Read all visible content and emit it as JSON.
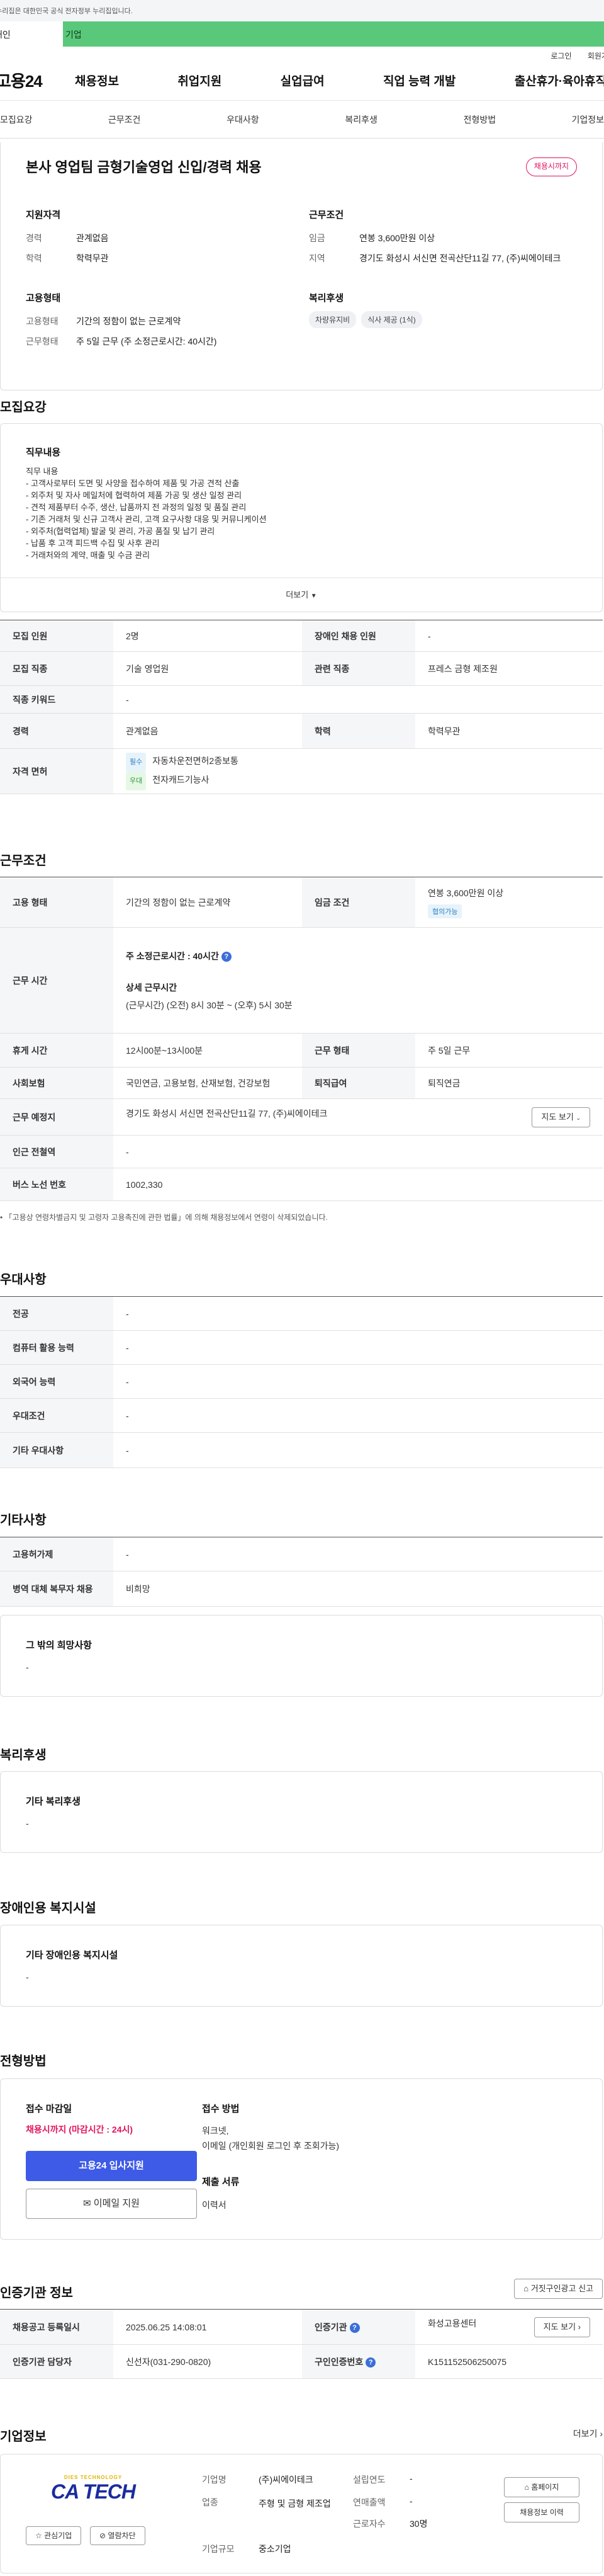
{
  "gov_bar": {
    "text": "이 누리집은 대한민국 공식 전자정부 누리집입니다."
  },
  "channel_tabs": {
    "personal": "개인",
    "corporate": "기업"
  },
  "util": {
    "login": "로그인",
    "signup": "회원가입"
  },
  "gnb": {
    "logo": "고용24",
    "menu": [
      "채용정보",
      "취업지원",
      "실업급여",
      "직업 능력 개발",
      "출산휴가·육아휴직"
    ]
  },
  "subnav": [
    "모집요강",
    "근무조건",
    "우대사항",
    "복리후생",
    "전형방법",
    "기업정보"
  ],
  "summary": {
    "title": "본사 영업팀 금형기술영업 신입/경력 채용",
    "deadline_badge": "채용시까지",
    "qualification": {
      "label": "지원자격",
      "career_k": "경력",
      "career_v": "관계없음",
      "edu_k": "학력",
      "edu_v": "학력무관"
    },
    "conditions": {
      "label": "근무조건",
      "wage_k": "임금",
      "wage_v": "연봉 3,600만원 이상",
      "region_k": "지역",
      "region_v": "경기도 화성시 서신면 전곡산단11길 77, (주)씨에이테크"
    },
    "employment": {
      "label": "고용형태",
      "type_k": "고용형태",
      "type_v": "기간의 정함이 없는 근로계약",
      "hours_k": "근무형태",
      "hours_v": "주 5일 근무 (주 소정근로시간: 40시간)"
    },
    "welfare": {
      "label": "복리후생",
      "chips": [
        "차량유지비",
        "식사 제공 (1식)"
      ]
    }
  },
  "recruit": {
    "section_title": "모집요강",
    "duty_label": "직무내용",
    "duty_lines": [
      "직무 내용",
      "- 고객사로부터 도면 및 사양을 접수하여 제품 및 가공 견적 산출",
      "- 외주처 및 자사 메일처에 협력하여 제품 가공 및 생산 일정 관리",
      "- 견적 제품부터 수주, 생산, 납품까지 전 과정의 일정 및 품질 관리",
      "- 기존 거래처 및 신규 고객사 관리, 고객 요구사항 대응 및 커뮤니케이션",
      "- 외주처(협력업체) 발굴 및 관리, 가공 품질 및 납기 관리",
      "- 납품 후 고객 피드백 수집 및 사후 관리",
      "- 거래처와의 계약, 매출 및 수금 관리"
    ],
    "more": "더보기",
    "rows": {
      "count_k": "모집 인원",
      "count_v": "2명",
      "disabled_k": "장애인 채용 인원",
      "disabled_v": "-",
      "job_k": "모집 직종",
      "job_v": "기술 영업원",
      "related_k": "관련 직종",
      "related_v": "프레스 금형 제조원",
      "keyword_k": "직종 키워드",
      "keyword_v": "-",
      "career_k": "경력",
      "career_v": "관계없음",
      "edu_k": "학력",
      "edu_v": "학력무관",
      "license_k": "자격 면허",
      "license_req_tag": "필수",
      "license_req": "자동차운전면허2종보통",
      "license_pref_tag": "우대",
      "license_pref": "전자캐드기능사"
    }
  },
  "work": {
    "section_title": "근무조건",
    "type_k": "고용 형태",
    "type_v": "기간의 정함이 없는 근로계약",
    "wage_k": "임금 조건",
    "wage_v": "연봉 3,600만원 이상",
    "wage_badge": "협의가능",
    "time_k": "근무 시간",
    "time_week": "주 소정근로시간 : 40시간",
    "time_detail_label": "상세 근무시간",
    "time_detail": "(근무시간) (오전) 8시 30분 ~ (오후) 5시 30분",
    "break_k": "휴게 시간",
    "break_v": "12시00분~13시00분",
    "shift_k": "근무 형태",
    "shift_v": "주 5일 근무",
    "insurance_k": "사회보험",
    "insurance_v": "국민연금, 고용보험, 산재보험, 건강보험",
    "retire_k": "퇴직급여",
    "retire_v": "퇴직연금",
    "place_k": "근무 예정지",
    "place_v": "경기도 화성시 서신면 전곡산단11길 77, (주)씨에이테크",
    "map_btn": "지도 보기",
    "subway_k": "인근 전철역",
    "subway_v": "-",
    "bus_k": "버스 노선 번호",
    "bus_v": "1002,330",
    "note": "「고용상 연령차별금지 및 고령자 고용촉진에 관한 법률」에 의해 채용정보에서 연령이 삭제되었습니다."
  },
  "pref": {
    "section_title": "우대사항",
    "rows": [
      {
        "k": "전공",
        "v": "-"
      },
      {
        "k": "컴퓨터 활용 능력",
        "v": "-"
      },
      {
        "k": "외국어 능력",
        "v": "-"
      },
      {
        "k": "우대조건",
        "v": "-"
      },
      {
        "k": "기타 우대사항",
        "v": "-"
      }
    ]
  },
  "etc": {
    "section_title": "기타사항",
    "rows": [
      {
        "k": "고용허가제",
        "v": "-"
      },
      {
        "k": "병역 대체 복무자 채용",
        "v": "비희망"
      }
    ],
    "other_label": "그 밖의 희망사항",
    "other_v": "-"
  },
  "benefit": {
    "section_title": "복리후생",
    "label": "기타 복리후생",
    "v": "-"
  },
  "disabled_fac": {
    "section_title": "장애인용 복지시설",
    "label": "기타 장애인용 복지시설",
    "v": "-"
  },
  "apply": {
    "section_title": "전형방법",
    "deadline_label": "접수 마감일",
    "deadline_v": "채용시까지 (마감시간 : 24시)",
    "apply_btn": "고용24 입사지원",
    "email_btn": "이메일 지원",
    "method_label": "접수 방법",
    "method_v1": "워크넷,",
    "method_v2": "이메일 (개인회원 로그인 후 조회가능)",
    "docs_label": "제출 서류",
    "docs_v": "이력서"
  },
  "cert": {
    "section_title": "인증기관 정보",
    "report_btn": "거짓구인광고 신고",
    "reg_k": "채용공고 등록일시",
    "reg_v": "2025.06.25 14:08:01",
    "org_k": "인증기관",
    "org_v": "화성고용센터",
    "map_btn": "지도 보기",
    "staff_k": "인증기관 담당자",
    "staff_v": "신선자(031-290-0820)",
    "no_k": "구인인증번호",
    "no_v": "K151152506250075"
  },
  "company": {
    "section_title": "기업정보",
    "more": "더보기",
    "logo_sub": "DIES TECHNOLOGY",
    "logo_main": "CA TECH",
    "fav_btn": "관심기업",
    "block_btn": "열람차단",
    "name_k": "기업명",
    "name_v": "(주)씨에이테크",
    "ind_k": "업종",
    "ind_v": "주형 및 금형 제조업",
    "size_k": "기업규모",
    "size_v": "중소기업",
    "found_k": "설립연도",
    "found_v": "-",
    "sales_k": "연매출액",
    "sales_v": "-",
    "emp_k": "근로자수",
    "emp_v": "30명",
    "home_btn": "홈페이지",
    "jobs_btn": "채용정보 이력"
  },
  "colors": {
    "accent_green": "#5ac87a",
    "badge_red": "#e2145f",
    "primary_blue": "#3d5be6"
  }
}
